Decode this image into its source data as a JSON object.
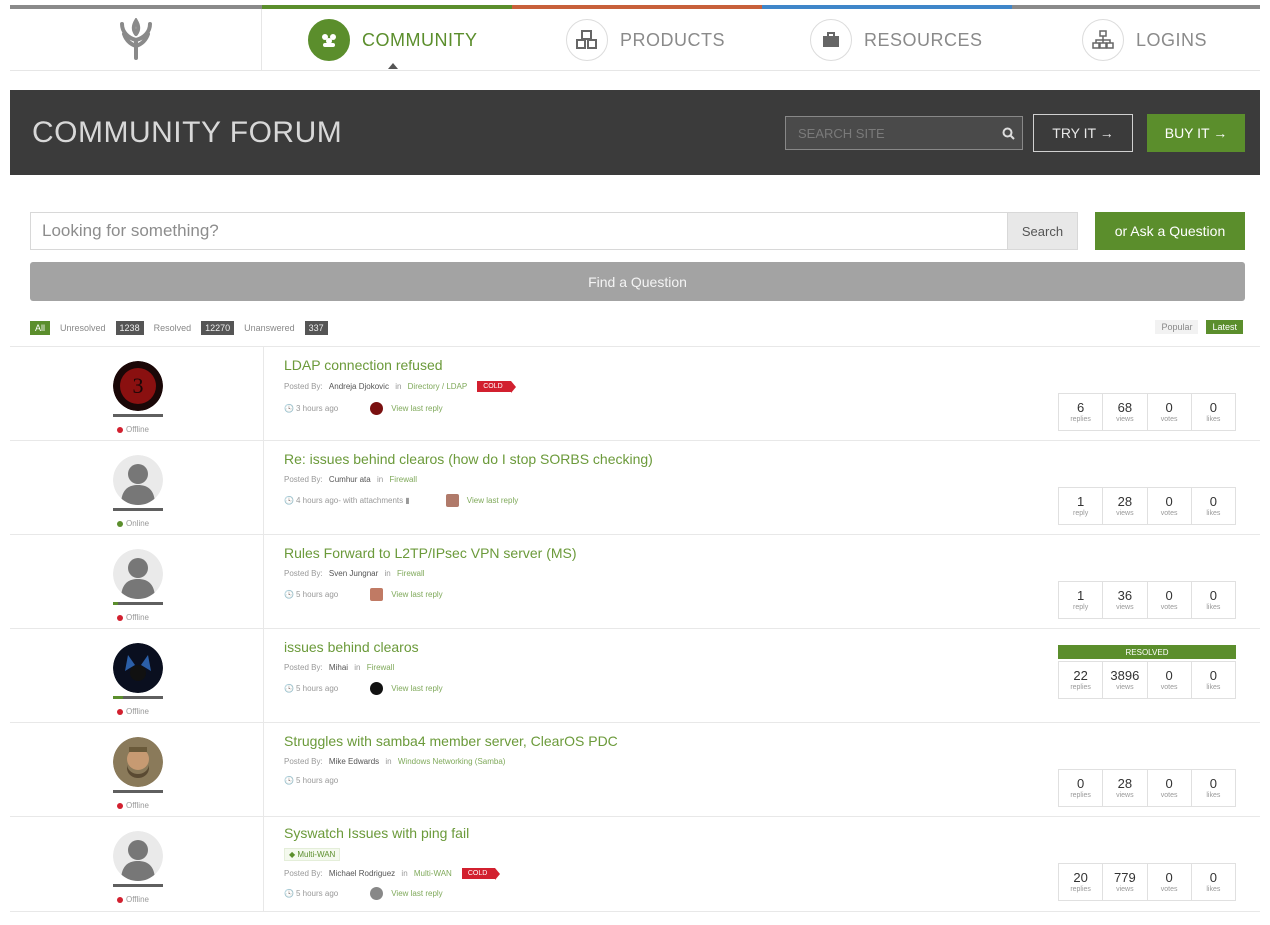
{
  "nav": {
    "items": [
      {
        "label": "COMMUNITY",
        "icon": "community-icon",
        "active": true
      },
      {
        "label": "PRODUCTS",
        "icon": "products-icon"
      },
      {
        "label": "RESOURCES",
        "icon": "resources-icon"
      },
      {
        "label": "LOGINS",
        "icon": "logins-icon"
      }
    ],
    "stripe_colors": [
      "#8a8a8a",
      "#5b8e2c",
      "#c8603a",
      "#3f86c9",
      "#8a8a8a"
    ]
  },
  "header": {
    "title": "COMMUNITY FORUM",
    "search_placeholder": "SEARCH SITE",
    "try_label": "TRY IT →",
    "buy_label": "BUY IT →"
  },
  "search": {
    "placeholder": "Looking for something?",
    "button_label": "Search",
    "ask_label": "or Ask a Question",
    "find_label": "Find a Question"
  },
  "filters": {
    "tabs": [
      {
        "label": "All",
        "active": true
      },
      {
        "label": "Unresolved",
        "count": "1238"
      },
      {
        "label": "Resolved",
        "count": "12270"
      },
      {
        "label": "Unanswered",
        "count": "337"
      }
    ],
    "sort": [
      {
        "label": "Popular"
      },
      {
        "label": "Latest",
        "active": true
      }
    ]
  },
  "threads": [
    {
      "title": "LDAP connection refused",
      "posted_prefix": "Posted By:",
      "author": "Andreja Djokovic",
      "in_word": "in",
      "category": "Directory / LDAP",
      "tag": "COLD",
      "time": "3 hours ago",
      "attach": "",
      "last_reply": "View last reply",
      "status": "Offline",
      "status_color": "#d2202f",
      "stats": {
        "replies": "6",
        "replies_label": "replies",
        "views": "68",
        "views_label": "views",
        "votes": "0",
        "votes_label": "votes",
        "likes": "0",
        "likes_label": "likes"
      },
      "resolved": ""
    },
    {
      "title": "Re: issues behind clearos (how do I stop SORBS checking)",
      "posted_prefix": "Posted By:",
      "author": "Cumhur ata",
      "in_word": "in",
      "category": "Firewall",
      "tag": "",
      "time": "4 hours ago",
      "attach": " - with attachments",
      "last_reply": "View last reply",
      "status": "Online",
      "status_color": "#5b8e2c",
      "stats": {
        "replies": "1",
        "replies_label": "reply",
        "views": "28",
        "views_label": "views",
        "votes": "0",
        "votes_label": "votes",
        "likes": "0",
        "likes_label": "likes"
      },
      "resolved": ""
    },
    {
      "title": "Rules Forward to L2TP/IPsec VPN server (MS)",
      "posted_prefix": "Posted By:",
      "author": "Sven Jungnar",
      "in_word": "in",
      "category": "Firewall",
      "tag": "",
      "time": "5 hours ago",
      "attach": "",
      "last_reply": "View last reply",
      "status": "Offline",
      "status_color": "#d2202f",
      "stats": {
        "replies": "1",
        "replies_label": "reply",
        "views": "36",
        "views_label": "views",
        "votes": "0",
        "votes_label": "votes",
        "likes": "0",
        "likes_label": "likes"
      },
      "resolved": ""
    },
    {
      "title": "issues behind clearos",
      "posted_prefix": "Posted By:",
      "author": "Mihai",
      "in_word": "in",
      "category": "Firewall",
      "tag": "",
      "time": "5 hours ago",
      "attach": "",
      "last_reply": "View last reply",
      "status": "Offline",
      "status_color": "#d2202f",
      "stats": {
        "replies": "22",
        "replies_label": "replies",
        "views": "3896",
        "views_label": "views",
        "votes": "0",
        "votes_label": "votes",
        "likes": "0",
        "likes_label": "likes"
      },
      "resolved": "RESOLVED"
    },
    {
      "title": "Struggles with samba4 member server, ClearOS PDC",
      "posted_prefix": "Posted By:",
      "author": "Mike Edwards",
      "in_word": "in",
      "category": "Windows Networking (Samba)",
      "tag": "",
      "time": "5 hours ago",
      "attach": "",
      "last_reply": "",
      "status": "Offline",
      "status_color": "#d2202f",
      "stats": {
        "replies": "0",
        "replies_label": "replies",
        "views": "28",
        "views_label": "views",
        "votes": "0",
        "votes_label": "votes",
        "likes": "0",
        "likes_label": "likes"
      },
      "resolved": ""
    },
    {
      "title": "Syswatch Issues with ping fail",
      "label": "Multi-WAN",
      "posted_prefix": "Posted By:",
      "author": "Michael Rodriguez",
      "in_word": "in",
      "category": "Multi-WAN",
      "tag": "COLD",
      "time": "5 hours ago",
      "attach": "",
      "last_reply": "View last reply",
      "status": "Offline",
      "status_color": "#d2202f",
      "stats": {
        "replies": "20",
        "replies_label": "replies",
        "views": "779",
        "views_label": "views",
        "votes": "0",
        "votes_label": "votes",
        "likes": "0",
        "likes_label": "likes"
      },
      "resolved": ""
    }
  ],
  "colors": {
    "accent": "#5b8e2c",
    "header_bg": "#3b3b3b",
    "tag_red": "#d2202f"
  }
}
